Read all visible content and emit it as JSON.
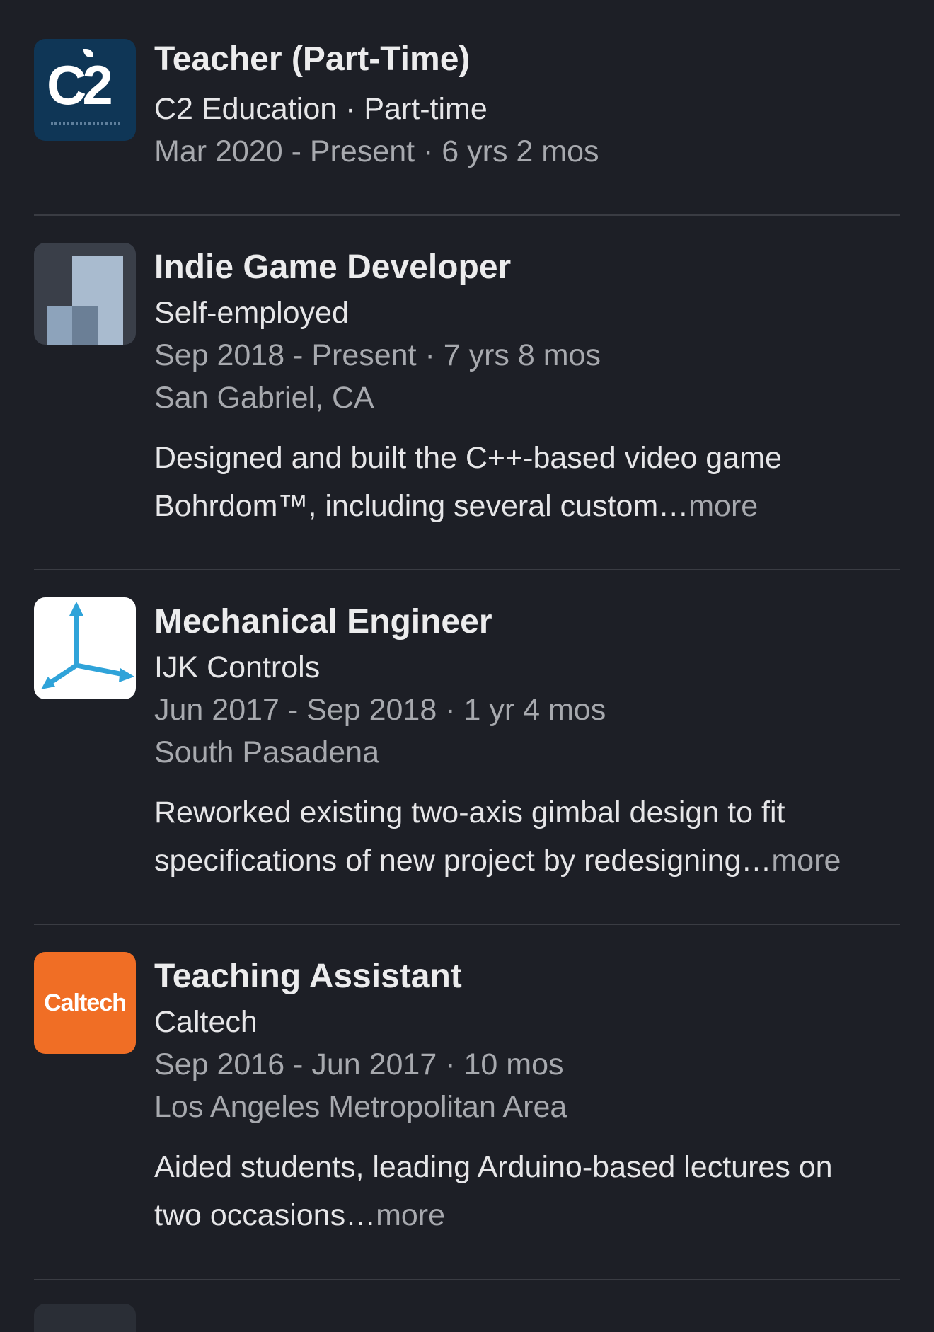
{
  "experience": [
    {
      "logo": "c2-education-logo",
      "logo_text": "C2",
      "title": "Teacher (Part-Time)",
      "company": "C2 Education · Part-time",
      "dates": "Mar 2020 - Present · 6 yrs 2 mos"
    },
    {
      "logo": "indie-game-logo",
      "title": "Indie Game Developer",
      "company": "Self-employed",
      "dates": "Sep 2018 - Present · 7 yrs 8 mos",
      "location": "San Gabriel, CA",
      "desc_line1": "Designed and built the C++-based video game",
      "desc_line2": "Bohrdom™, including several custom…",
      "more": "more"
    },
    {
      "logo": "ijk-controls-logo",
      "title": "Mechanical Engineer",
      "company": "IJK Controls",
      "dates": "Jun 2017 - Sep 2018 · 1 yr 4 mos",
      "location": "South Pasadena",
      "desc_line1": "Reworked existing two-axis gimbal design to fit",
      "desc_line2": "specifications of new project by redesigning…",
      "more": "more"
    },
    {
      "logo": "caltech-logo",
      "logo_text": "Caltech",
      "title": "Teaching Assistant",
      "company": "Caltech",
      "dates": "Sep 2016 - Jun 2017 · 10 mos",
      "location": "Los Angeles Metropolitan Area",
      "desc_line1": "Aided students, leading Arduino-based lectures on",
      "desc_line2": "two occasions…",
      "more": "more"
    }
  ],
  "colors": {
    "background": "#1d1f26",
    "primary_text": "#e9e9ea",
    "secondary_text": "#a7a9ae",
    "divider": "#3a3c43",
    "c2_blue": "#0f3656",
    "caltech_orange": "#f06e25",
    "ijk_axis_blue": "#2fa3d9"
  }
}
